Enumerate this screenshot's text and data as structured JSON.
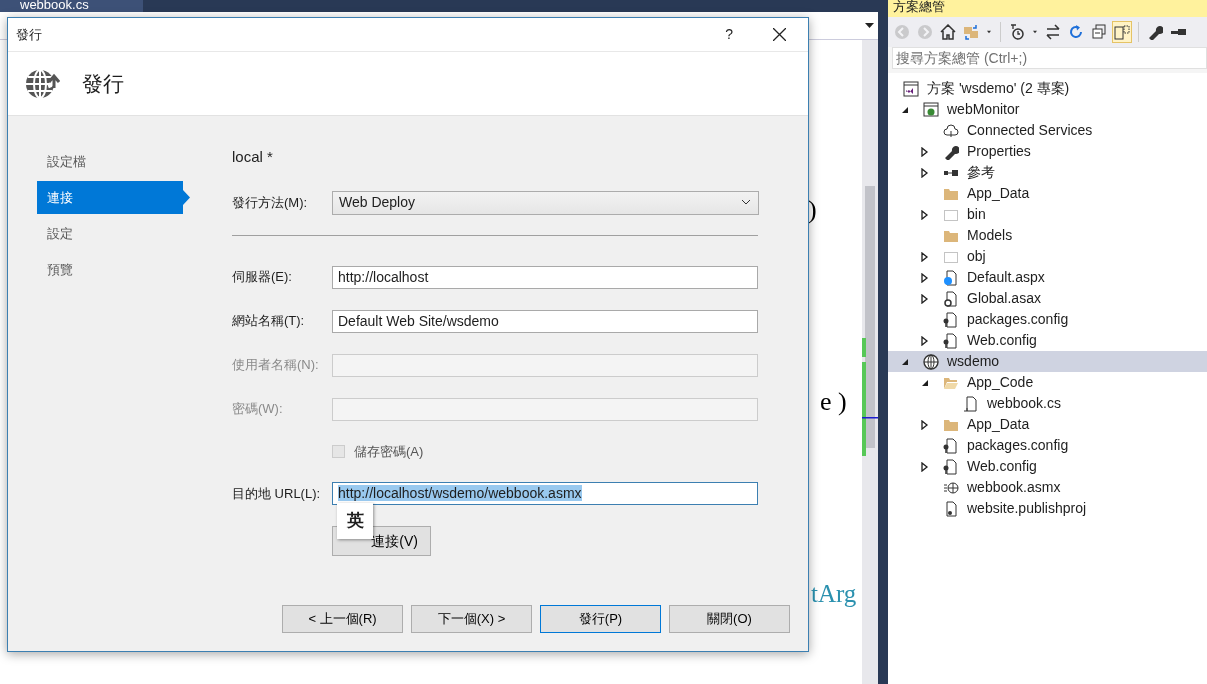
{
  "editor": {
    "tab": "webbook.cs",
    "code_fragments": [
      ")",
      "e )",
      "tArg"
    ]
  },
  "dialog": {
    "title": "發行",
    "help": "?",
    "header": "發行",
    "nav": [
      {
        "label": "設定檔",
        "selected": false
      },
      {
        "label": "連接",
        "selected": true
      },
      {
        "label": "設定",
        "selected": false
      },
      {
        "label": "預覽",
        "selected": false
      }
    ],
    "profile": "local *",
    "fields": [
      {
        "kind": "select",
        "label": "發行方法(M):",
        "value": "Web Deploy",
        "disabled": false
      },
      {
        "kind": "text",
        "label": "伺服器(E):",
        "value": "http://localhost",
        "disabled": false,
        "text_selected": false
      },
      {
        "kind": "text",
        "label": "網站名稱(T):",
        "value": "Default Web Site/wsdemo",
        "disabled": false,
        "text_selected": false
      },
      {
        "kind": "text",
        "label": "使用者名稱(N):",
        "disabled": true,
        "text_selected": false
      },
      {
        "kind": "text",
        "label": "密碼(W):",
        "disabled": true,
        "text_selected": false
      },
      {
        "kind": "checkbox",
        "label": "儲存密碼(A)",
        "checked": false,
        "disabled": true
      },
      {
        "kind": "text",
        "label": "目的地 URL(L):",
        "value": "http://localhost/wsdemo/webbook.asmx",
        "disabled": false,
        "text_selected": true
      },
      {
        "kind": "button",
        "label": "連接(V)"
      }
    ],
    "ime_indicator": "英",
    "buttons": [
      {
        "label": "< 上一個(R)",
        "focused": false
      },
      {
        "label": "下一個(X) >",
        "focused": false
      },
      {
        "label": "發行(P)",
        "focused": true
      },
      {
        "label": "關閉(O)",
        "focused": false
      }
    ]
  },
  "explorer": {
    "title": "方案總管",
    "toolbar": [
      {
        "kind": "back",
        "disabled": true,
        "pressed": false
      },
      {
        "kind": "forward",
        "disabled": true,
        "pressed": false
      },
      {
        "kind": "home",
        "disabled": false,
        "pressed": false
      },
      {
        "kind": "sync",
        "disabled": false,
        "pressed": false
      },
      {
        "kind": "caret",
        "disabled": false,
        "pressed": false
      },
      {
        "kind": "separator"
      },
      {
        "kind": "history",
        "disabled": false,
        "pressed": false
      },
      {
        "kind": "caret",
        "disabled": false,
        "pressed": false
      },
      {
        "kind": "swap",
        "disabled": false,
        "pressed": false
      },
      {
        "kind": "refresh",
        "disabled": false,
        "pressed": false
      },
      {
        "kind": "collapse",
        "disabled": false,
        "pressed": false
      },
      {
        "kind": "preview",
        "disabled": false,
        "pressed": true
      },
      {
        "kind": "separator"
      },
      {
        "kind": "wrench",
        "disabled": false,
        "pressed": false
      },
      {
        "kind": "minus",
        "disabled": false,
        "pressed": false
      }
    ],
    "search": {
      "placeholder": "搜尋方案總管 (Ctrl+;)"
    },
    "tree": [
      {
        "label": "方案 'wsdemo' (2 專案)",
        "kind": "solution",
        "selected": false,
        "children": [
          {
            "label": "webMonitor",
            "kind": "webproject",
            "expanded": true,
            "selected": false,
            "children": [
              {
                "label": "Connected Services",
                "kind": "cloud",
                "selected": false
              },
              {
                "label": "Properties",
                "kind": "wrench",
                "expanded": false,
                "selected": false
              },
              {
                "label": "參考",
                "kind": "references",
                "expanded": false,
                "selected": false
              },
              {
                "label": "App_Data",
                "kind": "folder",
                "selected": false
              },
              {
                "label": "bin",
                "kind": "hiddenfolder",
                "expanded": false,
                "selected": false
              },
              {
                "label": "Models",
                "kind": "folder",
                "selected": false
              },
              {
                "label": "obj",
                "kind": "hiddenfolder",
                "expanded": false,
                "selected": false
              },
              {
                "label": "Default.aspx",
                "kind": "webpage",
                "expanded": false,
                "selected": false
              },
              {
                "label": "Global.asax",
                "kind": "global",
                "expanded": false,
                "selected": false
              },
              {
                "label": "packages.config",
                "kind": "config",
                "selected": false
              },
              {
                "label": "Web.config",
                "kind": "config",
                "expanded": false,
                "selected": false
              }
            ]
          },
          {
            "label": "wsdemo",
            "kind": "website",
            "expanded": true,
            "selected": true,
            "children": [
              {
                "label": "App_Code",
                "kind": "openfolder",
                "expanded": true,
                "selected": false,
                "children": [
                  {
                    "label": "webbook.cs",
                    "kind": "file",
                    "selected": false
                  }
                ]
              },
              {
                "label": "App_Data",
                "kind": "folder",
                "expanded": false,
                "selected": false
              },
              {
                "label": "packages.config",
                "kind": "config",
                "selected": false
              },
              {
                "label": "Web.config",
                "kind": "config",
                "expanded": false,
                "selected": false
              },
              {
                "label": "webbook.asmx",
                "kind": "service",
                "selected": false
              },
              {
                "label": "website.publishproj",
                "kind": "publish",
                "selected": false
              }
            ]
          }
        ]
      }
    ]
  }
}
